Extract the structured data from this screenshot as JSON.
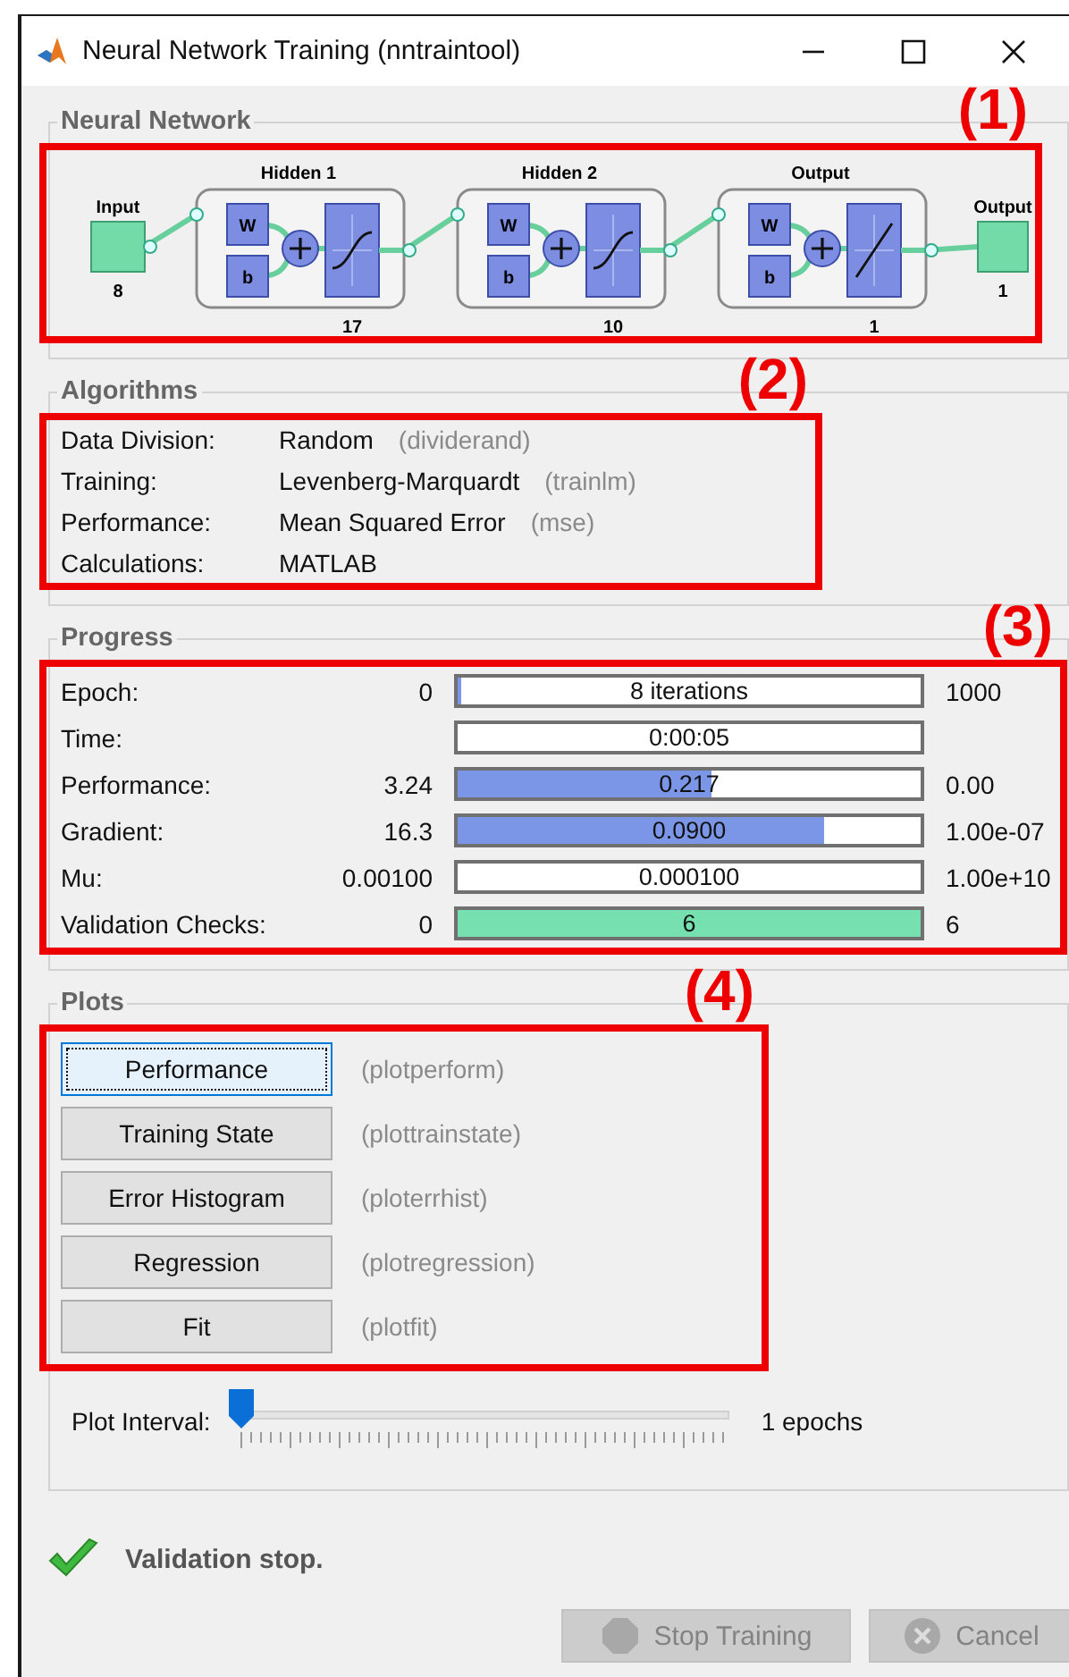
{
  "window": {
    "title": "Neural Network Training (nntraintool)"
  },
  "network": {
    "title": "Neural Network",
    "annotation": "(1)",
    "input": {
      "label": "Input",
      "size": "8"
    },
    "layers": [
      {
        "name": "Hidden 1",
        "weight": "W",
        "bias": "b",
        "kind": "sigmoid",
        "size": "17"
      },
      {
        "name": "Hidden 2",
        "weight": "W",
        "bias": "b",
        "kind": "sigmoid",
        "size": "10"
      },
      {
        "name": "Output",
        "weight": "W",
        "bias": "b",
        "kind": "linear",
        "size": "1"
      }
    ],
    "output": {
      "label": "Output",
      "size": "1"
    }
  },
  "algorithms": {
    "title": "Algorithms",
    "annotation": "(2)",
    "rows": [
      {
        "label": "Data Division:",
        "value": "Random",
        "function": "(dividerand)"
      },
      {
        "label": "Training:",
        "value": "Levenberg-Marquardt",
        "function": "(trainlm)"
      },
      {
        "label": "Performance:",
        "value": "Mean Squared Error",
        "function": "(mse)"
      },
      {
        "label": "Calculations:",
        "value": "MATLAB"
      }
    ]
  },
  "progress": {
    "title": "Progress",
    "annotation": "(3)",
    "rows": [
      {
        "label": "Epoch:",
        "start": "0",
        "value": "8 iterations",
        "level": 0.008,
        "end": "1000",
        "color": "#7b96e6"
      },
      {
        "label": "Time:",
        "value": "0:00:05",
        "level": 0
      },
      {
        "label": "Performance:",
        "start": "3.24",
        "value": "0.217",
        "level": 0.55,
        "end": "0.00",
        "color": "#7b96e6"
      },
      {
        "label": "Gradient:",
        "start": "16.3",
        "value": "0.0900",
        "level": 0.79,
        "end": "1.00e-07",
        "color": "#7b96e6"
      },
      {
        "label": "Mu:",
        "start": "0.00100",
        "value": "0.000100",
        "level": 0,
        "end": "1.00e+10"
      },
      {
        "label": "Validation Checks:",
        "start": "0",
        "value": "6",
        "level": 1,
        "end": "6",
        "color": "#76e0b0"
      }
    ]
  },
  "plots": {
    "title": "Plots",
    "annotation": "(4)",
    "buttons": [
      {
        "label": "Performance",
        "function": "(plotperform)",
        "selected": true
      },
      {
        "label": "Training State",
        "function": "(plottrainstate)",
        "selected": false
      },
      {
        "label": "Error Histogram",
        "function": "(ploterrhist)",
        "selected": false
      },
      {
        "label": "Regression",
        "function": "(plotregression)",
        "selected": false
      },
      {
        "label": "Fit",
        "function": "(plotfit)",
        "selected": false
      }
    ],
    "interval": {
      "label": "Plot Interval:",
      "level": 0,
      "reading": "1 epochs"
    }
  },
  "status": {
    "text": "Validation stop."
  },
  "actions": [
    {
      "label": "Stop Training",
      "kind": "stop",
      "disabled": true
    },
    {
      "label": "Cancel",
      "kind": "cancel",
      "disabled": true
    }
  ]
}
